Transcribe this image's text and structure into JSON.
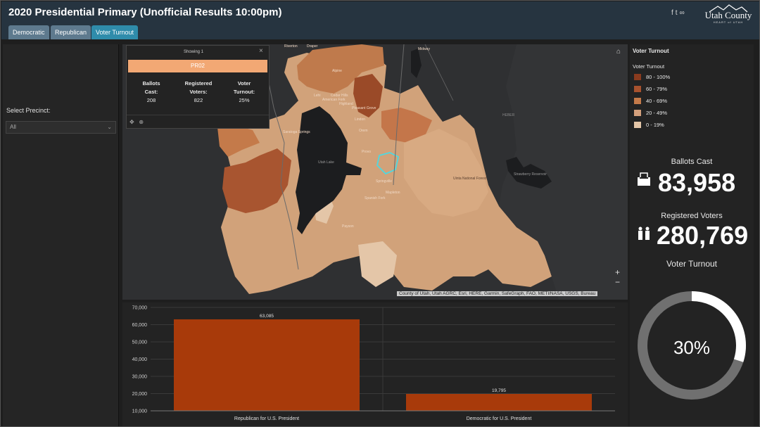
{
  "header": {
    "title": "2020 Presidential Primary (Unofficial Results 10:00pm)",
    "tabs": [
      {
        "label": "Democratic"
      },
      {
        "label": "Republican"
      },
      {
        "label": "Voter Turnout"
      }
    ],
    "active_tab": "Voter Turnout",
    "logo": {
      "name": "Utah County",
      "tagline": "HEART of UTAH"
    },
    "social_icons": [
      "facebook-icon",
      "twitter-icon",
      "link-icon"
    ]
  },
  "sidebar": {
    "select_label": "Select Precinct:",
    "select_value": "All"
  },
  "map": {
    "attribution": "County of Utah, Utah AGRC, Esri, HERE, Garmin, SafeGraph, FAO, METI/NASA, USGS, Bureau",
    "places": [
      "Riverton",
      "Draper",
      "Midway",
      "Cedar Hills",
      "Alpine",
      "Lehi",
      "American Fork",
      "Highland",
      "Pleasant Grove",
      "Lindon",
      "Orem",
      "Utah Lake",
      "Provo",
      "Springville",
      "Mapleton",
      "Spanish Fork",
      "Payson",
      "HEBER",
      "Uinta National Forest",
      "Strawberry Reservoir",
      "Saratoga Springs"
    ],
    "popup": {
      "count_text": "Showing 1",
      "precinct_id": "PR02",
      "fields": [
        {
          "label": "Ballots Cast:",
          "value": "208"
        },
        {
          "label": "Registered Voters:",
          "value": "822"
        },
        {
          "label": "Voter Turnout:",
          "value": "25%"
        }
      ]
    }
  },
  "legend": {
    "title": "Voter Turnout",
    "subtitle": "Voter Turnout",
    "items": [
      {
        "label": "80 - 100%",
        "color": "#8a3b1e"
      },
      {
        "label": "60 - 79%",
        "color": "#a8522e"
      },
      {
        "label": "40 - 69%",
        "color": "#c47a4a"
      },
      {
        "label": "20 - 49%",
        "color": "#d4a07c"
      },
      {
        "label": "0 - 19%",
        "color": "#e4c6a8"
      }
    ]
  },
  "stats": {
    "ballots_label": "Ballots Cast",
    "ballots_value": "83,958",
    "registered_label": "Registered Voters",
    "registered_value": "280,769",
    "turnout_label": "Voter Turnout",
    "turnout_value": "30%",
    "turnout_fraction": 0.3
  },
  "chart_data": {
    "type": "bar",
    "categories": [
      "Republican for U.S. President",
      "Democratic for U.S. President"
    ],
    "values": [
      63085,
      19795
    ],
    "value_labels": [
      "63,085",
      "19,795"
    ],
    "ylim": [
      10000,
      70000
    ],
    "yticks": [
      "70,000",
      "60,000",
      "50,000",
      "40,000",
      "30,000",
      "20,000",
      "10,000"
    ],
    "ytick_values": [
      70000,
      60000,
      50000,
      40000,
      30000,
      20000,
      10000
    ],
    "bar_color": "#a83a0a",
    "grid": true
  }
}
